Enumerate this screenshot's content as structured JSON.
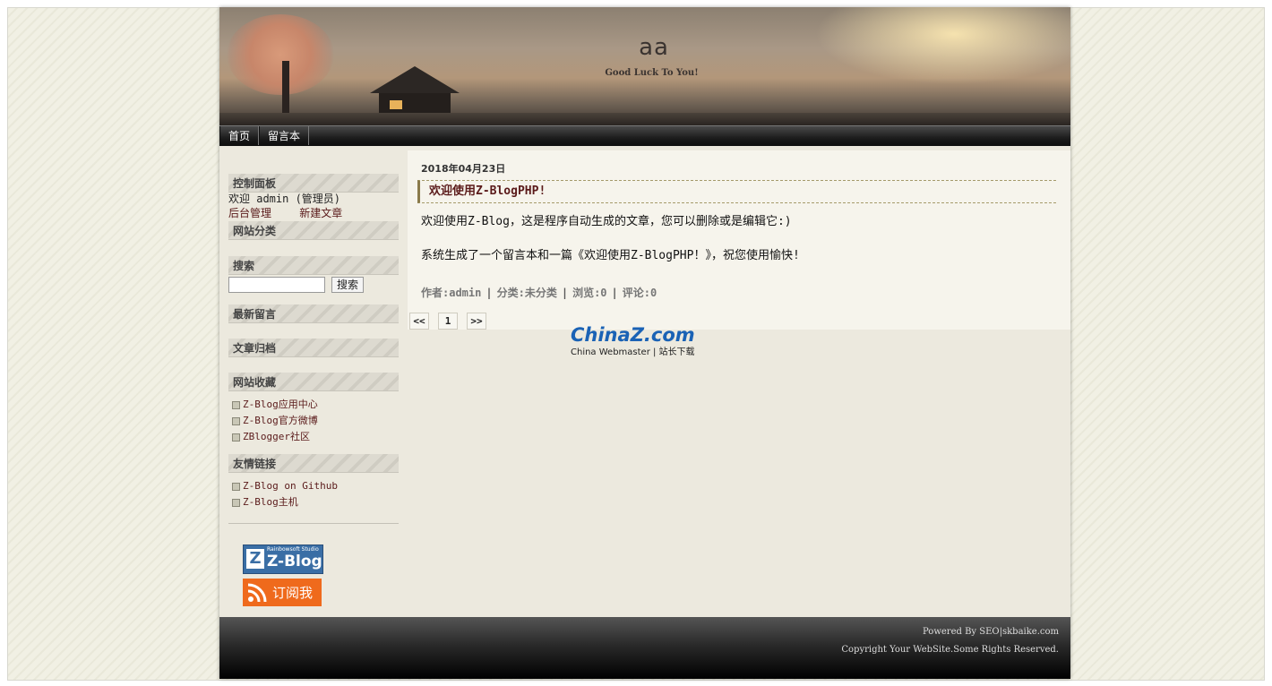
{
  "site": {
    "title": "aa",
    "subtitle": "Good Luck To You!"
  },
  "nav": [
    {
      "label": "首页"
    },
    {
      "label": "留言本"
    }
  ],
  "sidebar": {
    "control_panel": {
      "title": "控制面板",
      "welcome": "欢迎 admin (管理员)",
      "admin_link": "后台管理",
      "new_post_link": "新建文章"
    },
    "categories": {
      "title": "网站分类"
    },
    "search": {
      "title": "搜索",
      "button": "搜索",
      "value": ""
    },
    "latest_comments": {
      "title": "最新留言"
    },
    "archives": {
      "title": "文章归档"
    },
    "favorites": {
      "title": "网站收藏",
      "items": [
        "Z-Blog应用中心",
        "Z-Blog官方微博",
        "ZBlogger社区"
      ]
    },
    "links": {
      "title": "友情链接",
      "items": [
        "Z-Blog on Github",
        "Z-Blog主机"
      ]
    },
    "badges": {
      "zblog_small": "Rainbowsoft Studio",
      "zblog_big": "Z-Blog",
      "rss": "订阅我"
    }
  },
  "post": {
    "date": "2018年04月23日",
    "title": "欢迎使用Z-BlogPHP!",
    "body": [
      "欢迎使用Z-Blog，这是程序自动生成的文章，您可以删除或是编辑它:)",
      "系统生成了一个留言本和一篇《欢迎使用Z-BlogPHP！》，祝您使用愉快!"
    ],
    "meta": {
      "author": "作者:admin",
      "category": "分类:未分类",
      "views": "浏览:0",
      "comments": "评论:0"
    }
  },
  "pager": {
    "prev": "<<",
    "current": "1",
    "next": ">>"
  },
  "watermark": {
    "main_a": "China",
    "main_b": "Z",
    "main_c": ".com",
    "sub": "China Webmaster | 站长下载"
  },
  "footer": {
    "line1": "Powered By SEO|skbaike.com",
    "line2": "Copyright Your WebSite.Some Rights Reserved."
  },
  "colors": {
    "link": "#5a1a1a",
    "accent_blue": "#3a6ea5",
    "rss_orange": "#ef6a1c"
  }
}
